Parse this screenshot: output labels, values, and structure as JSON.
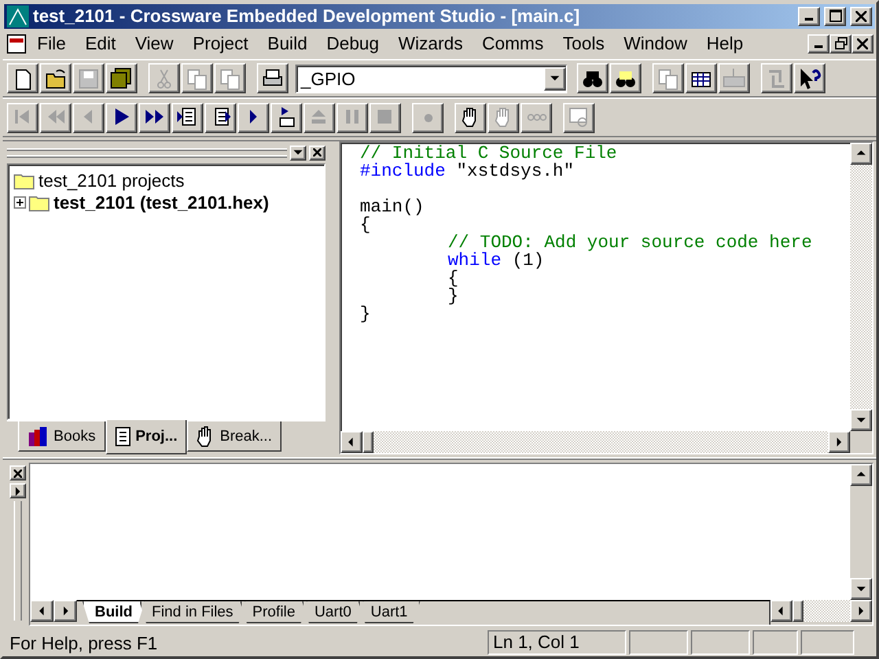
{
  "window": {
    "title": "test_2101 - Crossware Embedded Development Studio - [main.c]"
  },
  "menu": [
    "File",
    "Edit",
    "View",
    "Project",
    "Build",
    "Debug",
    "Wizards",
    "Comms",
    "Tools",
    "Window",
    "Help"
  ],
  "toolbar": [
    {
      "kind": "new",
      "disabled": false
    },
    {
      "kind": "open",
      "disabled": false
    },
    {
      "kind": "save",
      "disabled": true
    },
    {
      "kind": "save-all",
      "disabled": false
    },
    {
      "kind": "sep"
    },
    {
      "kind": "cut",
      "disabled": true
    },
    {
      "kind": "copy",
      "disabled": true
    },
    {
      "kind": "paste",
      "disabled": true
    },
    {
      "kind": "sep"
    },
    {
      "kind": "print",
      "disabled": false
    },
    {
      "kind": "combo",
      "value": "_GPIO"
    },
    {
      "kind": "find-files",
      "disabled": false
    },
    {
      "kind": "find",
      "disabled": false
    },
    {
      "kind": "sep"
    },
    {
      "kind": "stack",
      "disabled": true
    },
    {
      "kind": "grid",
      "disabled": false
    },
    {
      "kind": "keyboard",
      "disabled": true
    },
    {
      "kind": "sep"
    },
    {
      "kind": "arrows",
      "disabled": true
    },
    {
      "kind": "help",
      "disabled": false
    }
  ],
  "debug_toolbar": [
    {
      "kind": "first",
      "disabled": true
    },
    {
      "kind": "rewind",
      "disabled": true
    },
    {
      "kind": "back",
      "disabled": true
    },
    {
      "kind": "play",
      "disabled": false
    },
    {
      "kind": "fast-forward",
      "disabled": false
    },
    {
      "kind": "step-into",
      "disabled": false
    },
    {
      "kind": "step-over",
      "disabled": false
    },
    {
      "kind": "step",
      "disabled": false
    },
    {
      "kind": "step-out",
      "disabled": false
    },
    {
      "kind": "eject",
      "disabled": true
    },
    {
      "kind": "pause",
      "disabled": true
    },
    {
      "kind": "stop",
      "disabled": true
    },
    {
      "kind": "sep"
    },
    {
      "kind": "dot",
      "disabled": true
    },
    {
      "kind": "sep"
    },
    {
      "kind": "hand",
      "disabled": false
    },
    {
      "kind": "hand",
      "disabled": true
    },
    {
      "kind": "dots",
      "disabled": true
    },
    {
      "kind": "sep"
    },
    {
      "kind": "watch",
      "disabled": true
    }
  ],
  "workspace": {
    "tree": [
      {
        "label": "test_2101 projects",
        "active": false,
        "children": [
          {
            "label": "test_2101 (test_2101.hex)",
            "active": true,
            "expanded": false
          }
        ]
      }
    ],
    "tabs": [
      {
        "label": "Books",
        "selected": false
      },
      {
        "label": "Proj...",
        "selected": true
      },
      {
        "label": "Break...",
        "selected": false
      }
    ]
  },
  "editor": {
    "lines": [
      {
        "kind": "code",
        "indented": false,
        "tokens": [
          {
            "kind": "comment",
            "text": "// Initial C Source File"
          }
        ]
      },
      {
        "kind": "code",
        "indented": false,
        "tokens": [
          {
            "kind": "keyword",
            "text": "#include"
          },
          {
            "kind": "plain",
            "text": " \"xstdsys.h\""
          }
        ]
      },
      {
        "kind": "blank"
      },
      {
        "kind": "code",
        "indented": false,
        "tokens": [
          {
            "kind": "plain",
            "text": "main()"
          }
        ]
      },
      {
        "kind": "code",
        "indented": false,
        "tokens": [
          {
            "kind": "plain",
            "text": "{"
          }
        ]
      },
      {
        "kind": "code",
        "indented": true,
        "tokens": [
          {
            "kind": "comment",
            "text": "// TODO: Add your source code here"
          }
        ]
      },
      {
        "kind": "code",
        "indented": true,
        "tokens": [
          {
            "kind": "keyword",
            "text": "while"
          },
          {
            "kind": "plain",
            "text": " (1)"
          }
        ]
      },
      {
        "kind": "code",
        "indented": true,
        "tokens": [
          {
            "kind": "plain",
            "text": "{"
          }
        ]
      },
      {
        "kind": "code",
        "indented": true,
        "tokens": [
          {
            "kind": "plain",
            "text": "}"
          }
        ]
      },
      {
        "kind": "code",
        "indented": false,
        "tokens": [
          {
            "kind": "plain",
            "text": "}"
          }
        ]
      }
    ]
  },
  "output": {
    "tabs": [
      {
        "label": "Build",
        "selected": true
      },
      {
        "label": "Find in Files",
        "selected": false
      },
      {
        "label": "Profile",
        "selected": false
      },
      {
        "label": "Uart0",
        "selected": false
      },
      {
        "label": "Uart1",
        "selected": false
      }
    ]
  },
  "status_bar": {
    "message": "For Help, press F1",
    "position": "Ln 1, Col 1"
  }
}
